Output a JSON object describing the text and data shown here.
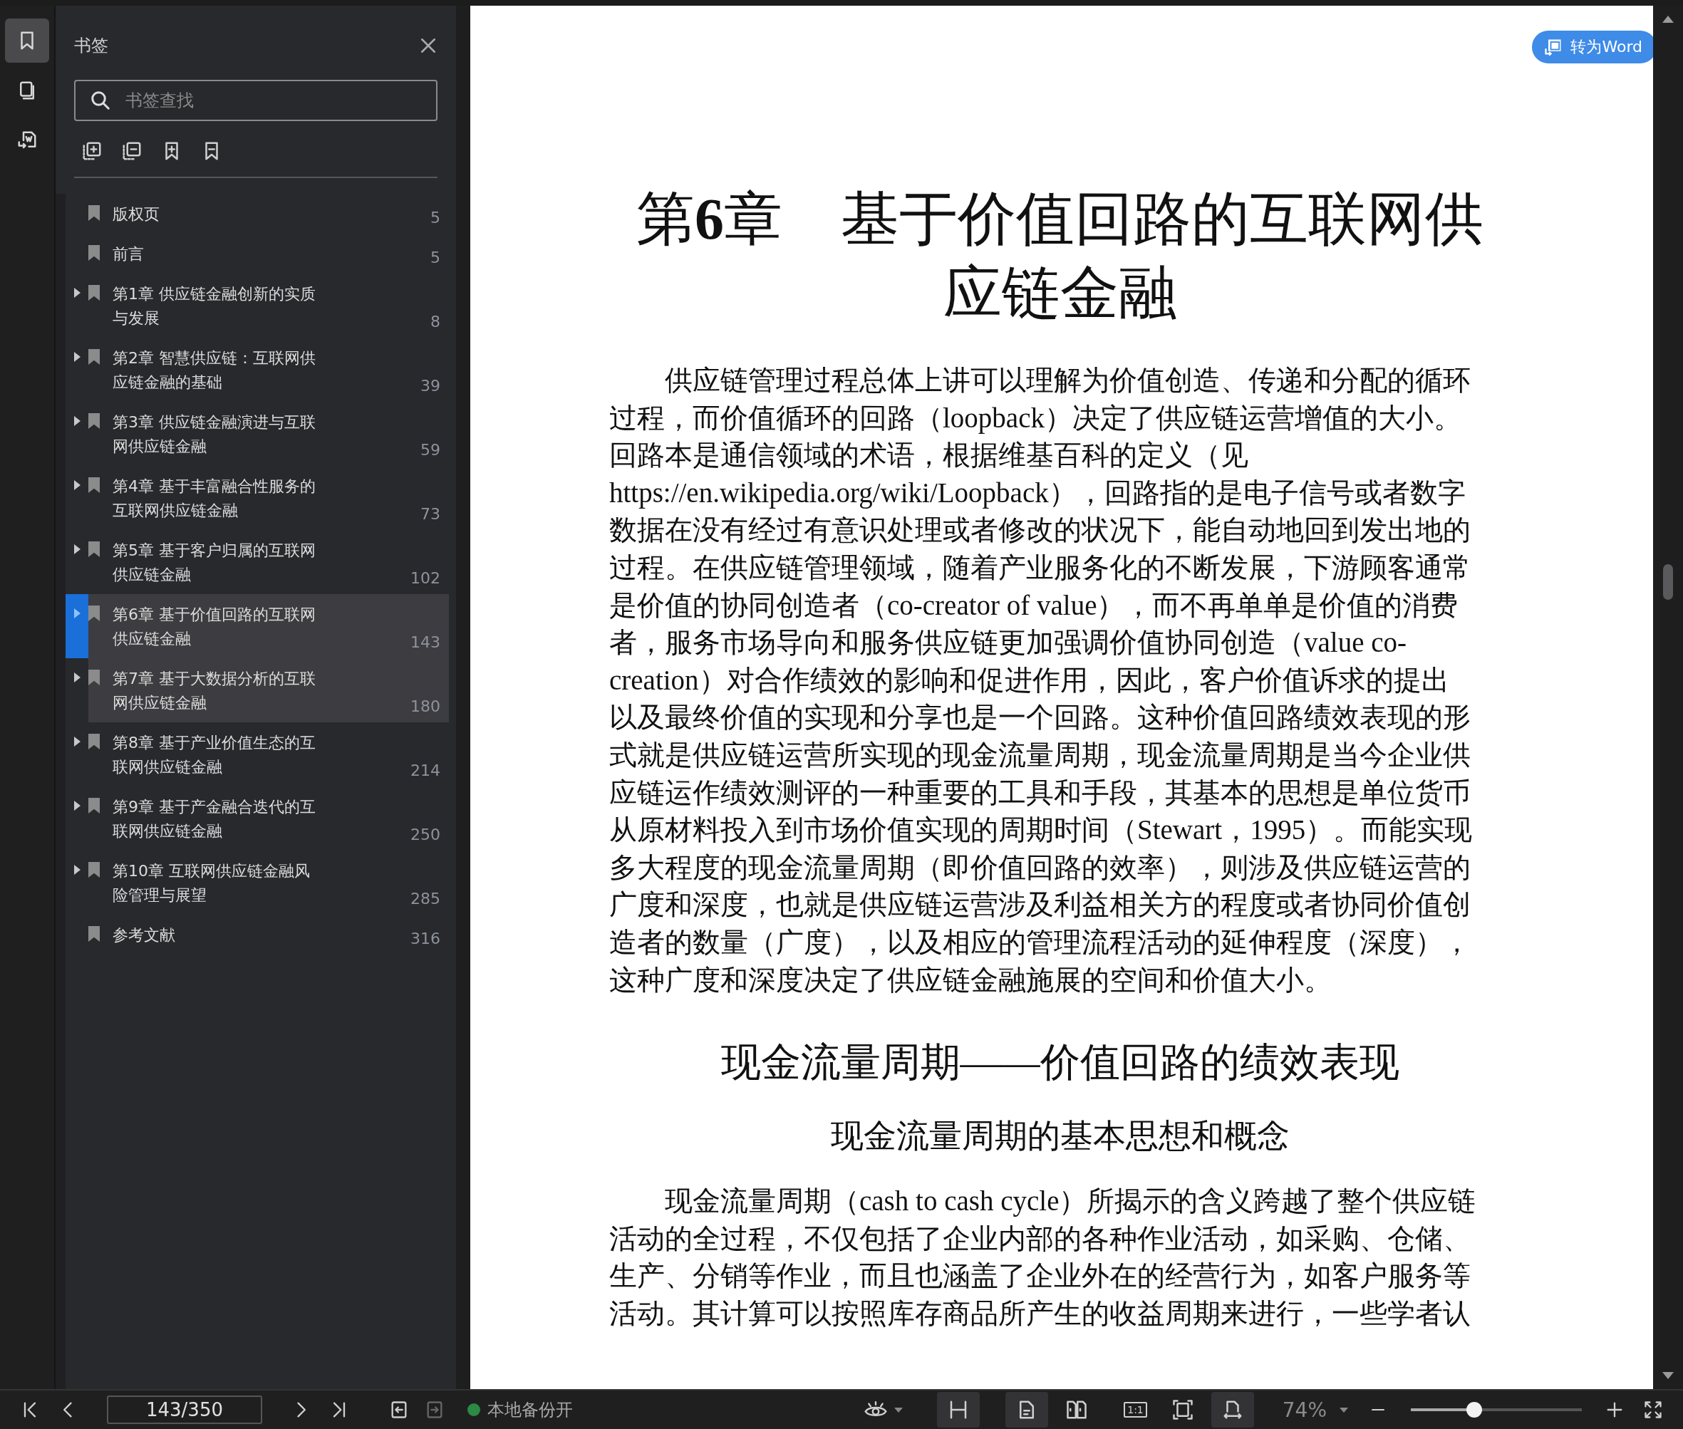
{
  "rail": [
    {
      "selected": true
    },
    {
      "selected": false
    },
    {
      "selected": false
    }
  ],
  "panel": {
    "title": "书签",
    "search": {
      "placeholder": "书签查找"
    },
    "items": [
      {
        "label": "版权页",
        "page": "5",
        "expandable": false,
        "selected": false,
        "highlighted": false
      },
      {
        "label": "前言",
        "page": "5",
        "expandable": false,
        "selected": false,
        "highlighted": false
      },
      {
        "label": "第1章 供应链金融创新的实质与发展",
        "page": "8",
        "expandable": true,
        "selected": false,
        "highlighted": false
      },
      {
        "label": "第2章 智慧供应链：互联网供应链金融的基础",
        "page": "39",
        "expandable": true,
        "selected": false,
        "highlighted": false
      },
      {
        "label": "第3章 供应链金融演进与互联网供应链金融",
        "page": "59",
        "expandable": true,
        "selected": false,
        "highlighted": false
      },
      {
        "label": "第4章 基于丰富融合性服务的互联网供应链金融",
        "page": "73",
        "expandable": true,
        "selected": false,
        "highlighted": false
      },
      {
        "label": "第5章 基于客户归属的互联网供应链金融",
        "page": "102",
        "expandable": true,
        "selected": false,
        "highlighted": false
      },
      {
        "label": "第6章 基于价值回路的互联网供应链金融",
        "page": "143",
        "expandable": true,
        "selected": true,
        "highlighted": true
      },
      {
        "label": "第7章 基于大数据分析的互联网供应链金融",
        "page": "180",
        "expandable": true,
        "selected": false,
        "highlighted": true
      },
      {
        "label": "第8章 基于产业价值生态的互联网供应链金融",
        "page": "214",
        "expandable": true,
        "selected": false,
        "highlighted": false
      },
      {
        "label": "第9章 基于产金融合迭代的互联网供应链金融",
        "page": "250",
        "expandable": true,
        "selected": false,
        "highlighted": false
      },
      {
        "label": "第10章 互联网供应链金融风险管理与展望",
        "page": "285",
        "expandable": true,
        "selected": false,
        "highlighted": false
      },
      {
        "label": "参考文献",
        "page": "316",
        "expandable": false,
        "selected": false,
        "highlighted": false
      }
    ]
  },
  "convert_button": {
    "label": "转为Word"
  },
  "document": {
    "title_lines": [
      "第**6**章　基于价值回路的互联网供",
      "应链金融"
    ],
    "blocks": [
      {
        "kind": "paragraph",
        "lines": [
          "供应链管理过程总体上讲可以理解为价值创造、传递和分配的循环",
          "过程，而价值循环的回路（loopback）决定了供应链运营增值的大小。",
          "回路本是通信领域的术语，根据维基百科的定义（见",
          "https://en.wikipedia.org/wiki/Loopback），回路指的是电子信号或者数字",
          "数据在没有经过有意识处理或者修改的状况下，能自动地回到发出地的",
          "过程。在供应链管理领域，随着产业服务化的不断发展，下游顾客通常",
          "是价值的协同创造者（co-creator of value），而不再单单是价值的消费",
          "者，服务市场导向和服务供应链更加强调价值协同创造（value co-",
          "creation）对合作绩效的影响和促进作用，因此，客户价值诉求的提出",
          "以及最终价值的实现和分享也是一个回路。这种价值回路绩效表现的形",
          "式就是供应链运营所实现的现金流量周期，现金流量周期是当今企业供",
          "应链运作绩效测评的一种重要的工具和手段，其基本的思想是单位货币",
          "从原材料投入到市场价值实现的周期时间（Stewart，1995）。而能实现",
          "多大程度的现金流量周期（即价值回路的效率），则涉及供应链运营的",
          "广度和深度，也就是供应链运营涉及利益相关方的程度或者协同价值创",
          "造者的数量（广度），以及相应的管理流程活动的延伸程度（深度），",
          "这种广度和深度决定了供应链金融施展的空间和价值大小。"
        ]
      },
      {
        "kind": "heading2",
        "text": "现金流量周期——价值回路的绩效表现"
      },
      {
        "kind": "heading3",
        "text": "现金流量周期的基本思想和概念"
      },
      {
        "kind": "paragraph",
        "lines": [
          "现金流量周期（cash to cash cycle）所揭示的含义跨越了整个供应链",
          "活动的全过程，不仅包括了企业内部的各种作业活动，如采购、仓储、",
          "生产、分销等作业，而且也涵盖了企业外在的经营行为，如客户服务等",
          "活动。其计算可以按照库存商品所产生的收益周期来进行，一些学者认"
        ]
      }
    ]
  },
  "bottom_bar": {
    "page_field": {
      "value": "143/350"
    },
    "backup": {
      "label": "本地备份开",
      "on": true
    },
    "view_tools": [
      {
        "selected": false
      },
      {
        "selected": true
      },
      {
        "selected": true
      },
      {
        "selected": false
      },
      {
        "label": "1:1",
        "selected": false
      },
      {
        "selected": false
      },
      {
        "selected": true
      }
    ],
    "zoom": {
      "value": "74%",
      "level": 0.37
    }
  }
}
